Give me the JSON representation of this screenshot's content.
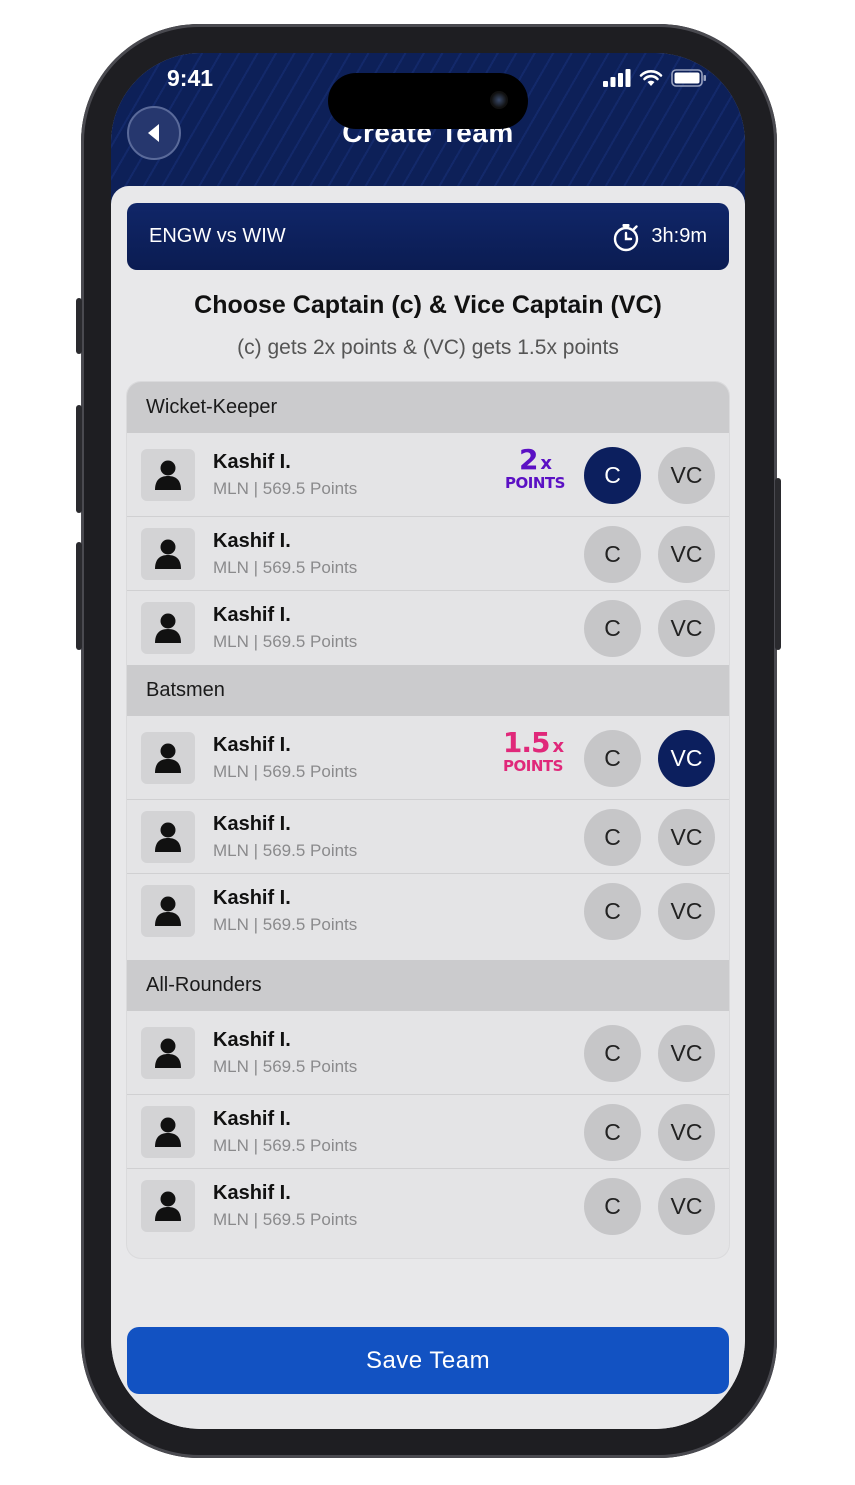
{
  "status_bar": {
    "time": "9:41"
  },
  "header": {
    "title": "Create Team"
  },
  "match": {
    "teams": "ENGW vs WIW",
    "time_left": "3h:9m"
  },
  "instructions": {
    "title": "Choose Captain (c) & Vice Captain (VC)",
    "subtitle": "(c) gets 2x points & (VC) gets 1.5x points"
  },
  "role_labels": {
    "captain": "C",
    "vice_captain": "VC"
  },
  "sections": [
    {
      "title": "Wicket-Keeper",
      "players": [
        {
          "name": "Kashif I.",
          "meta": "MLN | 569.5 Points",
          "selected": "captain",
          "badge_multiplier": "2",
          "badge_x": "x",
          "badge_label": "POINTS"
        },
        {
          "name": "Kashif I.",
          "meta": "MLN | 569.5 Points",
          "selected": ""
        },
        {
          "name": "Kashif I.",
          "meta": "MLN | 569.5 Points",
          "selected": ""
        }
      ]
    },
    {
      "title": "Batsmen",
      "players": [
        {
          "name": "Kashif I.",
          "meta": "MLN | 569.5 Points",
          "selected": "vice_captain",
          "badge_multiplier": "1.5",
          "badge_x": "x",
          "badge_label": "POINTS"
        },
        {
          "name": "Kashif I.",
          "meta": "MLN | 569.5 Points",
          "selected": ""
        },
        {
          "name": "Kashif I.",
          "meta": "MLN | 569.5 Points",
          "selected": ""
        }
      ]
    },
    {
      "title": "All-Rounders",
      "players": [
        {
          "name": "Kashif I.",
          "meta": "MLN | 569.5 Points",
          "selected": ""
        },
        {
          "name": "Kashif I.",
          "meta": "MLN | 569.5 Points",
          "selected": ""
        },
        {
          "name": "Kashif I.",
          "meta": "MLN | 569.5 Points",
          "selected": ""
        }
      ]
    }
  ],
  "footer": {
    "save_label": "Save Team"
  },
  "colors": {
    "primary": "#0c1f5e",
    "save_button": "#1252c2",
    "captain_badge": "#5b10c4",
    "vice_captain_badge": "#e0287a"
  }
}
